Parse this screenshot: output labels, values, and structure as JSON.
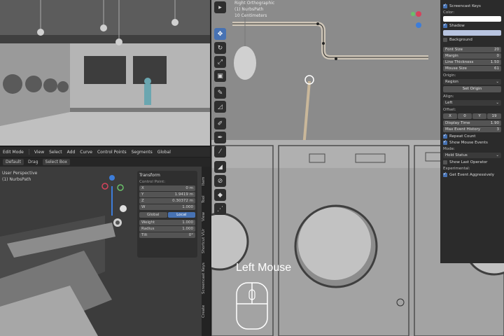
{
  "colors": {
    "accent": "#4772b3",
    "curve": "#c9b79a",
    "shadow_swatch": "#b8c4e0",
    "text_swatch": "#ffffff"
  },
  "edit_header": {
    "mode": "Edit Mode",
    "menus": [
      "View",
      "Select",
      "Add",
      "Curve",
      "Control Points",
      "Segments"
    ],
    "orientation": "Global"
  },
  "tool_header": {
    "pivot": "Default",
    "drag_label": "Drag",
    "drag_value": "Select Box"
  },
  "viewport": {
    "view_name": "User Perspective",
    "object_name": "(1) NurbsPath"
  },
  "transform_panel": {
    "title": "Transform",
    "section": "Control Point:",
    "fields": [
      {
        "label": "X",
        "value": "0 m"
      },
      {
        "label": "Y",
        "value": "1.9419 m"
      },
      {
        "label": "Z",
        "value": "0.30372 m"
      },
      {
        "label": "W",
        "value": "1.000"
      }
    ],
    "space": [
      "Global",
      "Local"
    ],
    "space_selected": "Local",
    "extra": [
      {
        "label": "Weight",
        "value": "1.000"
      },
      {
        "label": "Radius",
        "value": "1.000"
      },
      {
        "label": "Tilt",
        "value": "0°"
      }
    ]
  },
  "side_tabs": [
    "Item",
    "Tool",
    "View",
    "Shortcut VUr",
    "Screencast Keys",
    "Create"
  ],
  "main_hud": {
    "line1": "Right Orthographic",
    "line2": "(1) NurbsPath",
    "line3": "10 Centimeters"
  },
  "toolbar_icons": [
    "cursor-icon",
    "move-icon",
    "rotate-icon",
    "scale-icon",
    "transform-icon",
    "annotate-icon",
    "measure-icon",
    "draw-icon",
    "pen-icon",
    "knife-icon",
    "tilt-icon",
    "radius-icon",
    "extrude-icon",
    "randomize-icon"
  ],
  "screencast_panel": {
    "header": "Screencast Keys",
    "color_label": "Color:",
    "shadow_label": "Shadow",
    "background_label": "Background",
    "fields": [
      {
        "label": "Font Size",
        "value": "20"
      },
      {
        "label": "Margin",
        "value": "0"
      },
      {
        "label": "Line Thickness",
        "value": "1.50"
      },
      {
        "label": "Mouse Size",
        "value": "61"
      }
    ],
    "origin_label": "Origin:",
    "origin_value": "Region",
    "set_origin": "Set Origin",
    "align_label": "Align:",
    "align_value": "Left",
    "offset_label": "Offset:",
    "offset_values": [
      "X",
      "0",
      "Y",
      "19"
    ],
    "display_time_label": "Display Time",
    "display_time_value": "1.90",
    "max_history_label": "Max Event History",
    "max_history_value": "3",
    "repeat_count": "Repeat Count",
    "show_mouse_events": "Show Mouse Events",
    "mode_label": "Mode:",
    "mode_value": "Hold Status",
    "show_last_operator": "Show Last Operator",
    "experimental_label": "Experimental:",
    "get_event_aggressively": "Get Event Aggressively"
  },
  "mouse_overlay": {
    "label": "Left Mouse"
  }
}
